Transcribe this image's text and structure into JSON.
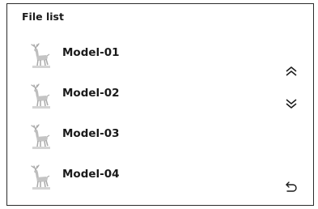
{
  "header": {
    "title": "File list"
  },
  "files": [
    {
      "name": "Model-01",
      "thumbnail_icon": "deer-model-icon"
    },
    {
      "name": "Model-02",
      "thumbnail_icon": "deer-model-icon"
    },
    {
      "name": "Model-03",
      "thumbnail_icon": "deer-model-icon"
    },
    {
      "name": "Model-04",
      "thumbnail_icon": "deer-model-icon"
    }
  ],
  "controls": {
    "page_up_icon": "double-chevron-up-icon",
    "page_down_icon": "double-chevron-down-icon",
    "back_icon": "return-arrow-icon"
  },
  "colors": {
    "text": "#1a1a1a",
    "border": "#2b2b2b",
    "thumbnail": "#b9b9b9"
  }
}
